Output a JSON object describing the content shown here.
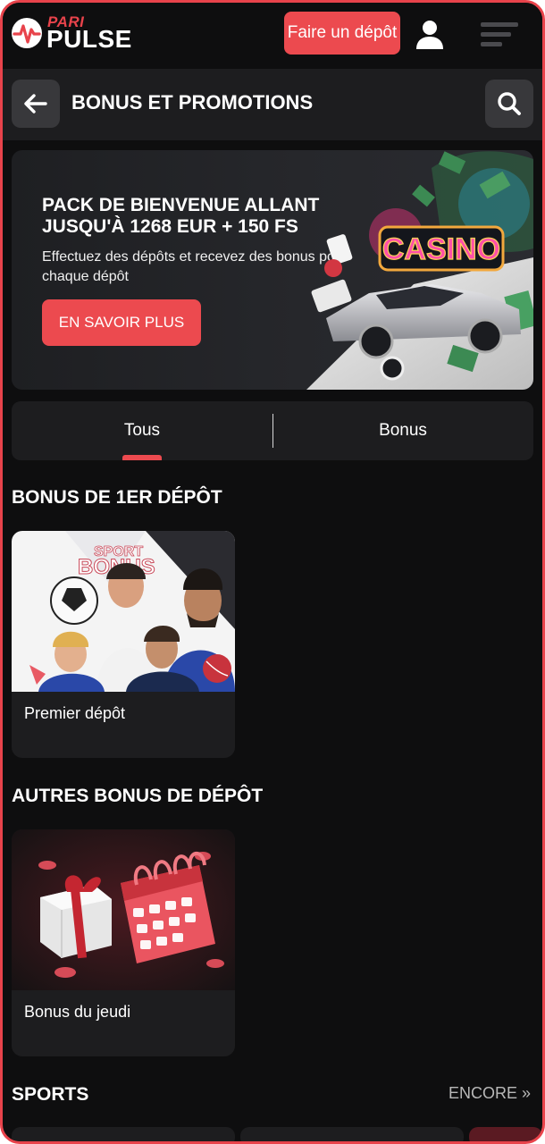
{
  "brand": {
    "pari": "PARI",
    "pulse": "PULSE"
  },
  "topbar": {
    "deposit_label": "Faire un dépôt"
  },
  "header": {
    "title": "BONUS ET PROMOTIONS"
  },
  "hero": {
    "title": "PACK DE BIENVENUE ALLANT JUSQU'À 1268 EUR + 150 FS",
    "subtitle": "Effectuez des dépôts et recevez des bonus pour chaque dépôt",
    "button_label": "EN SAVOIR PLUS",
    "sign_text": "CASINO"
  },
  "tabs": [
    {
      "label": "Tous",
      "active": true
    },
    {
      "label": "Bonus",
      "active": false
    }
  ],
  "sections": [
    {
      "title": "BONUS DE 1ER DÉPÔT",
      "cards": [
        {
          "label": "Premier dépôt",
          "art_text": [
            "SPORT",
            "BONUS"
          ]
        }
      ]
    },
    {
      "title": "AUTRES BONUS DE DÉPÔT",
      "cards": [
        {
          "label": "Bonus du jeudi"
        }
      ]
    },
    {
      "title": "SPORTS",
      "more_label": "ENCORE »"
    }
  ],
  "colors": {
    "accent": "#ec4a4f",
    "background": "#0e0e0f",
    "surface": "#1d1d1f",
    "button_surface": "#38383b",
    "frame_border": "#e8434b"
  },
  "icons": {
    "user": "user-icon",
    "menu": "menu-icon",
    "back": "arrow-left-icon",
    "search": "search-icon"
  }
}
